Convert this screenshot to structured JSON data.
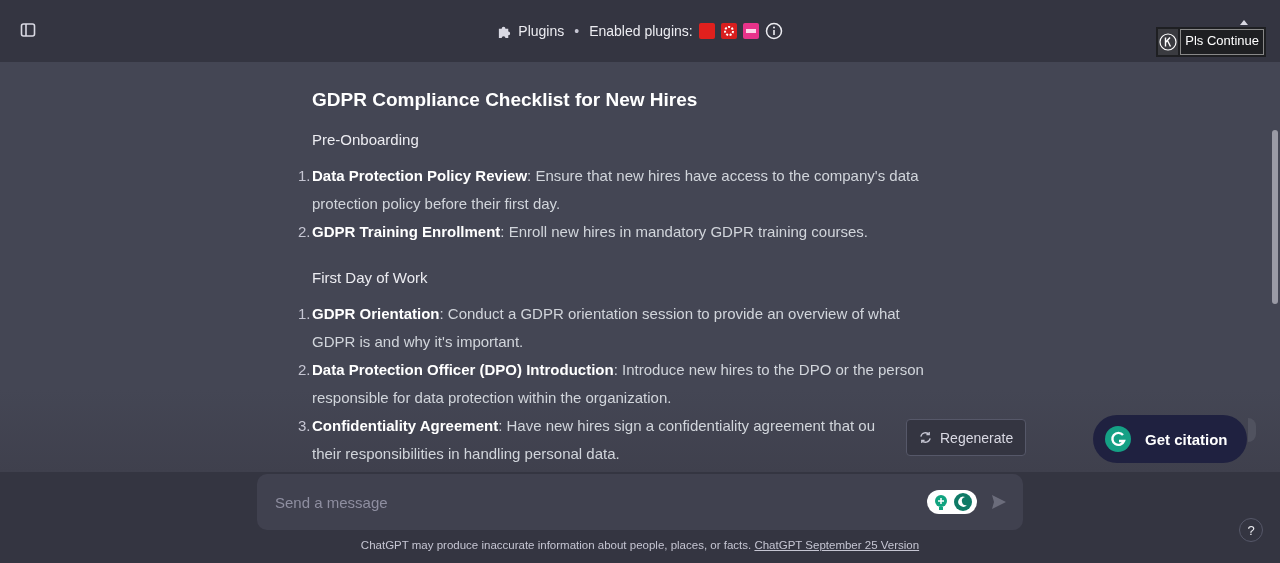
{
  "header": {
    "plugins_label": "Plugins",
    "separator": "•",
    "enabled_label": "Enabled plugins:"
  },
  "extension": {
    "label": "Pls Continue"
  },
  "document": {
    "title": "GDPR Compliance Checklist for New Hires",
    "sections": [
      {
        "heading": "Pre-Onboarding",
        "items": [
          {
            "number": "1.",
            "title": "Data Protection Policy Review",
            "lines": [
              ": Ensure that new hires have access to the company's data",
              "protection policy before their first day."
            ]
          },
          {
            "number": "2.",
            "title": "GDPR Training Enrollment",
            "lines": [
              ": Enroll new hires in mandatory GDPR training courses."
            ]
          }
        ]
      },
      {
        "heading": "First Day of Work",
        "items": [
          {
            "number": "1.",
            "title": "GDPR Orientation",
            "lines": [
              ": Conduct a GDPR orientation session to provide an overview of what",
              "GDPR is and why it's important."
            ]
          },
          {
            "number": "2.",
            "title": "Data Protection Officer (DPO) Introduction",
            "lines": [
              ": Introduce new hires to the DPO or the person",
              "responsible for data protection within the organization."
            ]
          },
          {
            "number": "3.",
            "title": "Confidentiality Agreement",
            "lines": [
              ": Have new hires sign a confidentiality agreement that ou",
              "their responsibilities in handling personal data."
            ]
          }
        ]
      }
    ]
  },
  "regenerate": {
    "label": "Regenerate"
  },
  "citation": {
    "label": "Get citation"
  },
  "composer": {
    "placeholder": "Send a message"
  },
  "footer": {
    "text": "ChatGPT may produce inaccurate information about people, places, or facts.",
    "link": "ChatGPT September 25 Version"
  },
  "help": {
    "label": "?"
  }
}
